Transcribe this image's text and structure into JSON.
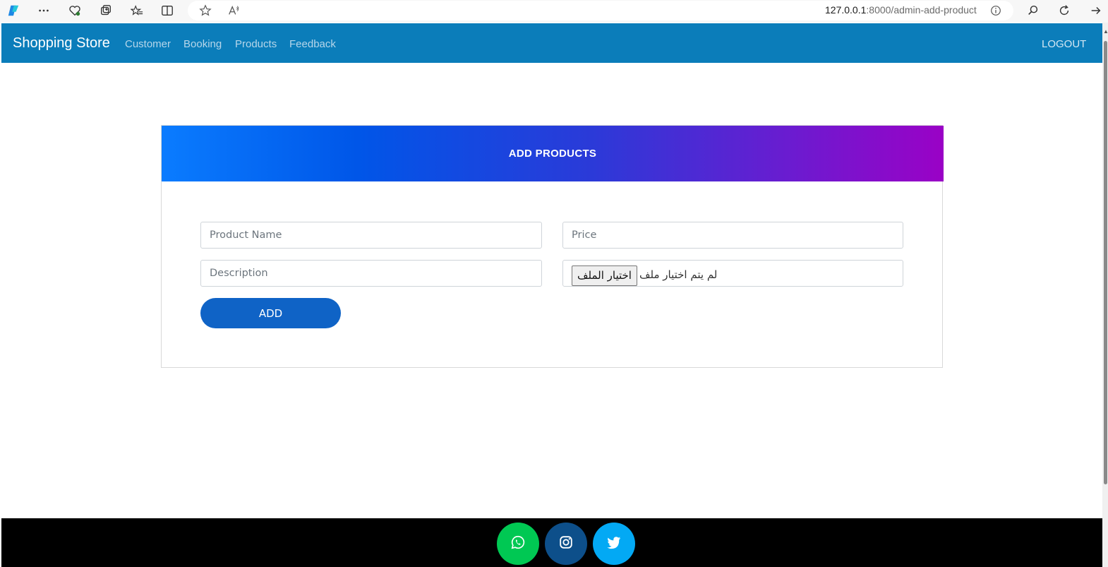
{
  "browser": {
    "address_host": "127.0.0.1",
    "address_rest": ":8000/admin-add-product"
  },
  "navbar": {
    "brand": "Shopping Store",
    "links": [
      "Customer",
      "Booking",
      "Products",
      "Feedback"
    ],
    "logout": "LOGOUT"
  },
  "form": {
    "title": "ADD PRODUCTS",
    "product_name_placeholder": "Product Name",
    "price_placeholder": "Price",
    "description_placeholder": "Description",
    "file_button": "اختيار الملف",
    "file_status": "لم يتم اختيار ملف",
    "submit": "ADD"
  },
  "footer": {
    "social": [
      {
        "icon": "whatsapp-icon",
        "color": "#00c853"
      },
      {
        "icon": "instagram-icon",
        "color": "#0d4f8a"
      },
      {
        "icon": "twitter-icon",
        "color": "#03a9f4"
      }
    ]
  },
  "colors": {
    "navbar": "#0b7dba",
    "header_gradient_start": "#0a7cff",
    "header_gradient_end": "#9a02c6",
    "button": "#0f63c6"
  }
}
